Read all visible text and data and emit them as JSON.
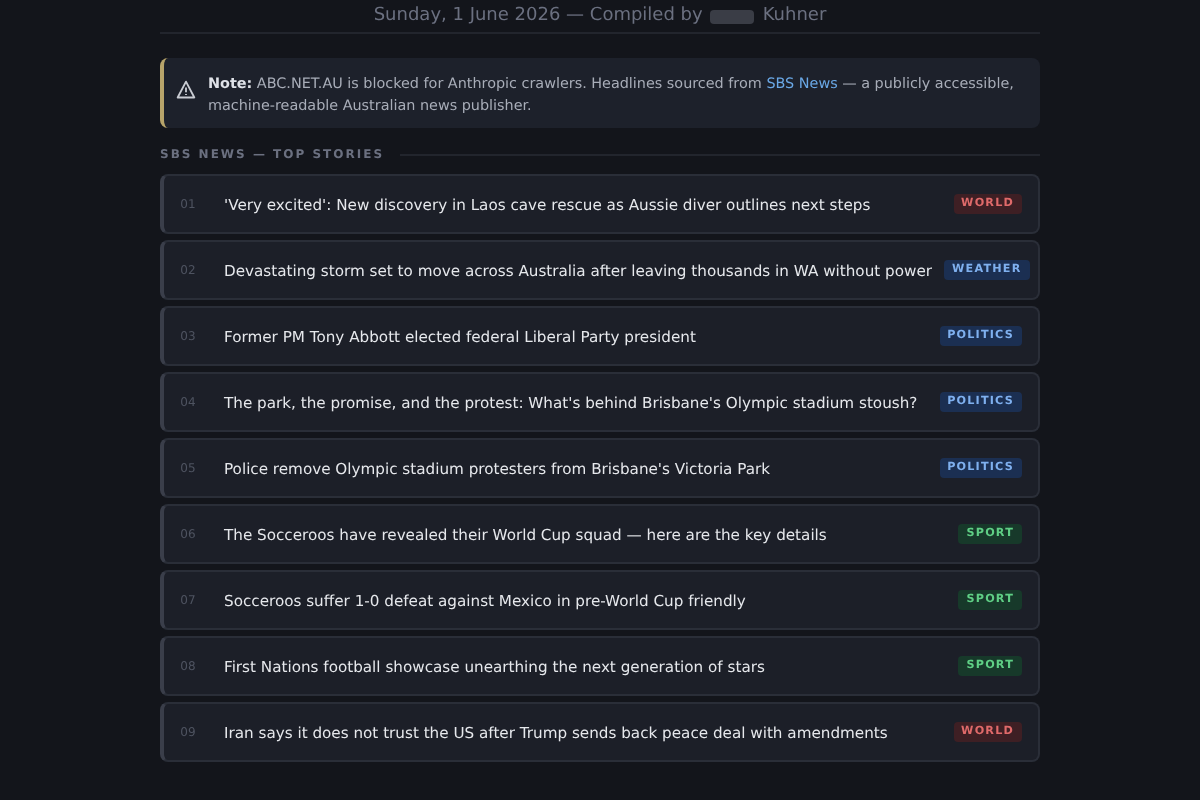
{
  "header": {
    "date_line": "Sunday, 1 June 2026 — Compiled by",
    "name_redacted": true,
    "name_after": "Kuhner"
  },
  "notice": {
    "text": "**Note:** ABC.NET.AU is blocked for Anthropic crawlers. Headlines sourced from",
    "link": "SBS News",
    "text_after": "— a publicly accessible, machine-readable Australian news publisher."
  },
  "section_title": "SBS NEWS — TOP STORIES",
  "stories": [
    {
      "number": "01",
      "headline": "'Very excited': New discovery in Laos cave rescue as Aussie diver outlines next steps",
      "tag": "WORLD",
      "kind": "world"
    },
    {
      "number": "02",
      "headline": "Devastating storm set to move across Australia after leaving thousands in WA without power",
      "tag": "WEATHER",
      "kind": "weather"
    },
    {
      "number": "03",
      "headline": "Former PM Tony Abbott elected federal Liberal Party president",
      "tag": "POLITICS",
      "kind": "politics"
    },
    {
      "number": "04",
      "headline": "The park, the promise, and the protest: What's behind Brisbane's Olympic stadium stoush?",
      "tag": "POLITICS",
      "kind": "politics"
    },
    {
      "number": "05",
      "headline": "Police remove Olympic stadium protesters from Brisbane's Victoria Park",
      "tag": "POLITICS",
      "kind": "politics"
    },
    {
      "number": "06",
      "headline": "The Socceroos have revealed their World Cup squad — here are the key details",
      "tag": "SPORT",
      "kind": "sport"
    },
    {
      "number": "07",
      "headline": "Socceroos suffer 1-0 defeat against Mexico in pre-World Cup friendly",
      "tag": "SPORT",
      "kind": "sport"
    },
    {
      "number": "08",
      "headline": "First Nations football showcase unearthing the next generation of stars",
      "tag": "SPORT",
      "kind": "sport"
    },
    {
      "number": "09",
      "headline": "Iran says it does not trust the US after Trump sends back peace deal with amendments",
      "tag": "WORLD",
      "kind": "world"
    }
  ]
}
